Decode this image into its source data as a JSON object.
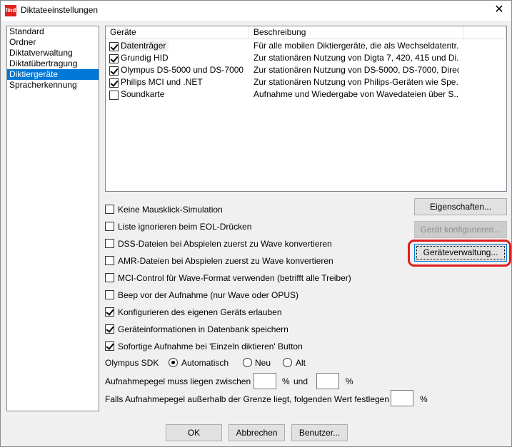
{
  "window": {
    "title": "Diktateeinstellungen",
    "app_icon_text": "find",
    "close_glyph": "✕"
  },
  "nav": {
    "items": [
      "Standard",
      "Ordner",
      "Diktatverwaltung",
      "Diktatübertragung",
      "Diktiergeräte",
      "Spracherkennung"
    ],
    "selected_index": 4
  },
  "device_list": {
    "columns": [
      "Geräte",
      "Beschreibung"
    ],
    "rows": [
      {
        "checked": true,
        "name": "Datenträger",
        "desc": "Für alle mobilen Diktiergeräte, die als Wechseldatentr..."
      },
      {
        "checked": true,
        "name": "Grundig HID",
        "desc": "Zur stationären Nutzung von Digta 7, 420, 415 und Di..."
      },
      {
        "checked": true,
        "name": "Olympus DS-5000 und DS-7000",
        "desc": "Zur stationären Nutzung von DS-5000, DS-7000, Direct..."
      },
      {
        "checked": true,
        "name": "Philips MCI und .NET",
        "desc": "Zur stationären Nutzung von Philips-Geräten wie Spe..."
      },
      {
        "checked": false,
        "name": "Soundkarte",
        "desc": "Aufnahme und Wiedergabe von Wavedateien über S..."
      }
    ]
  },
  "options": [
    {
      "checked": false,
      "label": "Keine Mausklick-Simulation"
    },
    {
      "checked": false,
      "label": "Liste ignorieren beim EOL-Drücken"
    },
    {
      "checked": false,
      "label": "DSS-Dateien bei Abspielen zuerst zu Wave konvertieren"
    },
    {
      "checked": false,
      "label": "AMR-Dateien bei Abspielen zuerst zu Wave konvertieren"
    },
    {
      "checked": false,
      "label": "MCI-Control für Wave-Format verwenden (betrifft alle Treiber)"
    },
    {
      "checked": false,
      "label": "Beep vor der Aufnahme (nur Wave oder OPUS)"
    },
    {
      "checked": true,
      "label": "Konfigurieren des eigenen Geräts erlauben"
    },
    {
      "checked": true,
      "label": "Geräteinformationen in Datenbank speichern"
    },
    {
      "checked": true,
      "label": "Sofortige Aufnahme bei 'Einzeln diktieren' Button"
    }
  ],
  "side_buttons": {
    "eigenschaften": "Eigenschaften...",
    "geraet_konfigurieren": "Gerät konfigurieren...",
    "geraeteverwaltung": "Geräteverwaltung..."
  },
  "olympus_sdk": {
    "label": "Olympus SDK",
    "options": [
      "Automatisch",
      "Neu",
      "Alt"
    ],
    "selected_index": 0
  },
  "level": {
    "label": "Aufnahmepegel muss liegen zwischen",
    "min": "",
    "percent1": "%",
    "and": "und",
    "max": "",
    "percent2": "%",
    "outside_label": "Falls Aufnahmepegel außerhalb der Grenze liegt, folgenden Wert festlegen",
    "outside_value": "",
    "percent3": "%"
  },
  "footer": {
    "ok": "OK",
    "cancel": "Abbrechen",
    "user": "Benutzer..."
  },
  "colors": {
    "selection": "#0078d7",
    "annotation": "#e01e1e"
  }
}
